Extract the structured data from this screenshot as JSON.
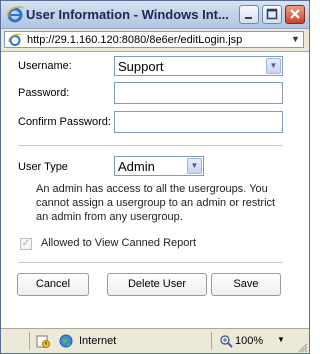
{
  "window": {
    "title": "User Information - Windows Int...",
    "address": "http://29.1.160.120:8080/8e6er/editLogin.jsp"
  },
  "form": {
    "username_label": "Username:",
    "username_value": "Support",
    "password_label": "Password:",
    "confirm_label": "Confirm Password:",
    "usertype_label": "User Type",
    "usertype_value": "Admin",
    "description": "An admin has access to all the usergroups. You cannot assign a usergroup to an admin or restrict an admin from any usergroup.",
    "canned_label": "Allowed to View Canned Report",
    "canned_checked": true
  },
  "buttons": {
    "cancel": "Cancel",
    "delete": "Delete User",
    "save": "Save"
  },
  "statusbar": {
    "zone": "Internet",
    "zoom": "100%"
  },
  "icons": [
    "ie-logo-icon",
    "minimize-icon",
    "maximize-icon",
    "close-icon",
    "page-icon",
    "chevron-down-icon",
    "privacy-icon",
    "globe-icon",
    "zoom-icon",
    "resize-grip-icon"
  ]
}
